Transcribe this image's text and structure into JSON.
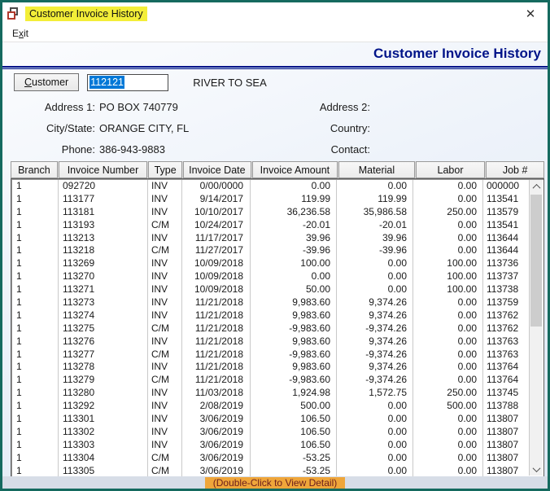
{
  "window": {
    "title": "Customer Invoice History",
    "close_glyph": "✕"
  },
  "menu": {
    "exit": {
      "pre": "E",
      "accel": "x",
      "post": "it"
    }
  },
  "header": {
    "title": "Customer Invoice History"
  },
  "customer": {
    "button": {
      "accel": "C",
      "post": "ustomer"
    },
    "number": "112121",
    "name": "RIVER TO SEA"
  },
  "details": {
    "address1_label": "Address 1:",
    "address1_value": "PO BOX 740779",
    "address2_label": "Address 2:",
    "address2_value": "",
    "citystate_label": "City/State:",
    "citystate_value": "ORANGE CITY, FL",
    "country_label": "Country:",
    "country_value": "",
    "phone_label": "Phone:",
    "phone_value": "386-943-9883",
    "contact_label": "Contact:",
    "contact_value": ""
  },
  "table": {
    "columns": [
      "Branch",
      "Invoice Number",
      "Type",
      "Invoice Date",
      "Invoice Amount",
      "Material",
      "Labor",
      "Job #"
    ],
    "rows": [
      [
        "1",
        "092720",
        "INV",
        "0/00/0000",
        "0.00",
        "0.00",
        "0.00",
        "000000"
      ],
      [
        "1",
        "113177",
        "INV",
        "9/14/2017",
        "119.99",
        "119.99",
        "0.00",
        "113541"
      ],
      [
        "1",
        "113181",
        "INV",
        "10/10/2017",
        "36,236.58",
        "35,986.58",
        "250.00",
        "113579"
      ],
      [
        "1",
        "113193",
        "C/M",
        "10/24/2017",
        "-20.01",
        "-20.01",
        "0.00",
        "113541"
      ],
      [
        "1",
        "113213",
        "INV",
        "11/17/2017",
        "39.96",
        "39.96",
        "0.00",
        "113644"
      ],
      [
        "1",
        "113218",
        "C/M",
        "11/27/2017",
        "-39.96",
        "-39.96",
        "0.00",
        "113644"
      ],
      [
        "1",
        "113269",
        "INV",
        "10/09/2018",
        "100.00",
        "0.00",
        "100.00",
        "113736"
      ],
      [
        "1",
        "113270",
        "INV",
        "10/09/2018",
        "0.00",
        "0.00",
        "100.00",
        "113737"
      ],
      [
        "1",
        "113271",
        "INV",
        "10/09/2018",
        "50.00",
        "0.00",
        "100.00",
        "113738"
      ],
      [
        "1",
        "113273",
        "INV",
        "11/21/2018",
        "9,983.60",
        "9,374.26",
        "0.00",
        "113759"
      ],
      [
        "1",
        "113274",
        "INV",
        "11/21/2018",
        "9,983.60",
        "9,374.26",
        "0.00",
        "113762"
      ],
      [
        "1",
        "113275",
        "C/M",
        "11/21/2018",
        "-9,983.60",
        "-9,374.26",
        "0.00",
        "113762"
      ],
      [
        "1",
        "113276",
        "INV",
        "11/21/2018",
        "9,983.60",
        "9,374.26",
        "0.00",
        "113763"
      ],
      [
        "1",
        "113277",
        "C/M",
        "11/21/2018",
        "-9,983.60",
        "-9,374.26",
        "0.00",
        "113763"
      ],
      [
        "1",
        "113278",
        "INV",
        "11/21/2018",
        "9,983.60",
        "9,374.26",
        "0.00",
        "113764"
      ],
      [
        "1",
        "113279",
        "C/M",
        "11/21/2018",
        "-9,983.60",
        "-9,374.26",
        "0.00",
        "113764"
      ],
      [
        "1",
        "113280",
        "INV",
        "11/03/2018",
        "1,924.98",
        "1,572.75",
        "250.00",
        "113745"
      ],
      [
        "1",
        "113292",
        "INV",
        "2/08/2019",
        "500.00",
        "0.00",
        "500.00",
        "113788"
      ],
      [
        "1",
        "113301",
        "INV",
        "3/06/2019",
        "106.50",
        "0.00",
        "0.00",
        "113807"
      ],
      [
        "1",
        "113302",
        "INV",
        "3/06/2019",
        "106.50",
        "0.00",
        "0.00",
        "113807"
      ],
      [
        "1",
        "113303",
        "INV",
        "3/06/2019",
        "106.50",
        "0.00",
        "0.00",
        "113807"
      ],
      [
        "1",
        "113304",
        "C/M",
        "3/06/2019",
        "-53.25",
        "0.00",
        "0.00",
        "113807"
      ],
      [
        "1",
        "113305",
        "C/M",
        "3/06/2019",
        "-53.25",
        "0.00",
        "0.00",
        "113807"
      ]
    ]
  },
  "footer": {
    "hint": "(Double-Click to View Detail)"
  },
  "colors": {
    "accent_navy": "#001489",
    "selection_blue": "#0078d7",
    "title_highlight_yellow": "#f3ee38",
    "hint_orange": "#efa63a",
    "hint_text_maroon": "#6b1d1d",
    "window_border_teal": "#156a5f"
  }
}
